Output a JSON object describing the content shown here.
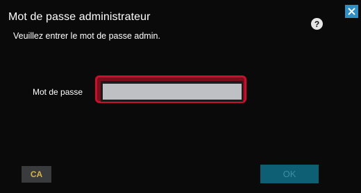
{
  "dialog": {
    "title": "Mot de passe administrateur",
    "subtitle": "Veuillez entrer le mot de passe admin."
  },
  "help": {
    "label": "?",
    "icon": "question-icon"
  },
  "close": {
    "icon": "close-x-icon",
    "color": "#2f8fc4"
  },
  "password": {
    "label": "Mot de passe",
    "value": "",
    "highlight_color": "#c8102e"
  },
  "buttons": {
    "ca": "CA",
    "ok": "OK"
  }
}
